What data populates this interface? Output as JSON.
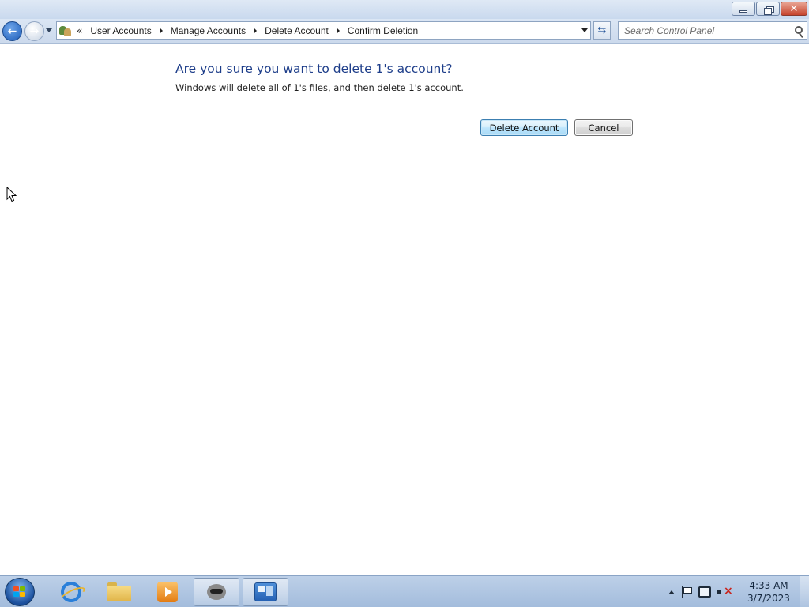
{
  "window": {
    "caption_buttons": {
      "minimize": "minimize-icon",
      "maximize": "restore-icon",
      "close": "close-icon"
    }
  },
  "nav": {
    "back": "back-arrow-icon",
    "forward": "forward-arrow-icon",
    "overflow": "«",
    "breadcrumbs": [
      "User Accounts",
      "Manage Accounts",
      "Delete Account",
      "Confirm Deletion"
    ],
    "search_placeholder": "Search Control Panel"
  },
  "content": {
    "heading": "Are you sure you want to delete 1's account?",
    "description": "Windows will delete all of 1's files, and then delete 1's account.",
    "buttons": {
      "delete": "Delete Account",
      "cancel": "Cancel"
    }
  },
  "taskbar": {
    "apps": [
      "internet-explorer-icon",
      "windows-explorer-icon",
      "media-player-icon",
      "raccoon-app-icon",
      "control-panel-icon"
    ],
    "active_app": "control-panel-icon",
    "tray_icons": [
      "show-hidden-icons-arrow",
      "action-center-flag-icon",
      "network-icon",
      "volume-muted-icon"
    ],
    "clock": {
      "time": "4:33 AM",
      "date": "3/7/2023"
    }
  },
  "colors": {
    "heading": "#1e3e8a",
    "primary_button_border": "#3c7fb1",
    "taskbar": "#a3bcdc"
  }
}
